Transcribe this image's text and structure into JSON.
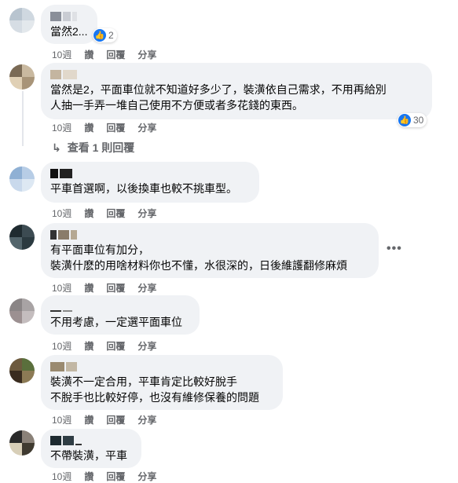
{
  "comments": [
    {
      "text": "當然2...",
      "time": "10週",
      "like": "讚",
      "reply": "回覆",
      "share": "分享",
      "reactions": "2"
    },
    {
      "text": "當然是2，平面車位就不知道好多少了，裝潢依自己需求，不用再給別\n人抽一手弄一堆自己使用不方便或者多花錢的東西。",
      "time": "10週",
      "like": "讚",
      "reply": "回覆",
      "share": "分享",
      "reactions": "30"
    },
    {
      "text": "平車首選啊，以後換車也較不挑車型。",
      "time": "10週",
      "like": "讚",
      "reply": "回覆",
      "share": "分享"
    },
    {
      "text": "有平面車位有加分，\n裝潢什麽的用啥材料你也不懂，水很深的，日後維護翻修麻煩",
      "time": "10週",
      "like": "讚",
      "reply": "回覆",
      "share": "分享"
    },
    {
      "text": "不用考慮，一定選平面車位",
      "time": "10週",
      "like": "讚",
      "reply": "回覆",
      "share": "分享"
    },
    {
      "text": "裝潢不一定合用，平車肯定比較好脫手\n不脫手也比較好停，也沒有維修保養的問題",
      "time": "10週",
      "like": "讚",
      "reply": "回覆",
      "share": "分享"
    },
    {
      "text": "不帶裝潢，平車",
      "time": "10週",
      "like": "讚",
      "reply": "回覆",
      "share": "分享"
    }
  ],
  "view_replies": "查看 1 則回覆",
  "more_options": "•••",
  "colors": {
    "bubble": "#f0f2f5",
    "meta": "#65676b",
    "like_blue": "#1877f2"
  },
  "icons": {
    "like": "like-icon",
    "reply_arrow": "reply-arrow-icon",
    "more": "more-options-icon"
  }
}
